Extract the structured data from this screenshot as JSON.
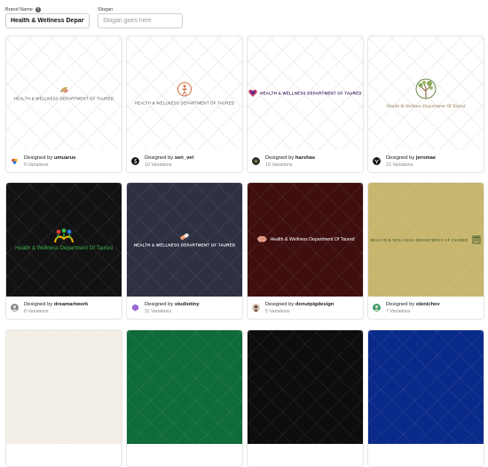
{
  "form": {
    "brand_label": "Brand Name",
    "brand_value": "Health & Wellness Departme",
    "slogan_label": "Slogan",
    "slogan_placeholder": "Slogan goes here"
  },
  "cards": [
    {
      "bg": "#ffffff",
      "logo_text": "HEALTH & WELLNESS DEPARTMENT OF TAURED",
      "text_color": "#444444",
      "designed_prefix": "Designed by",
      "designer": "umuarus",
      "variations": "9 Variations",
      "icon": "leaf-icon"
    },
    {
      "bg": "#ffffff",
      "logo_text": "HEALTH & WELLNESS DEPARTMENT OF TAURED",
      "text_color": "#444444",
      "designed_prefix": "Designed by",
      "designer": "sen_vel",
      "variations": "10 Variations",
      "icon": "circle-figure-icon"
    },
    {
      "bg": "#ffffff",
      "logo_text": "HEALTH & WELLNESS DEPARTMENT OF TAURED",
      "text_color": "#3a1a5c",
      "designed_prefix": "Designed by",
      "designer": "harshas",
      "variations": "15 Variations",
      "icon": "heart-icon"
    },
    {
      "bg": "#ffffff",
      "logo_text": "Health & Wellness Department Of Taured",
      "text_color": "#8a7a45",
      "designed_prefix": "Designed by",
      "designer": "jeromae",
      "variations": "22 Variations",
      "icon": "tree-icon"
    },
    {
      "bg": "#121212",
      "logo_text": "Health & Wellness Department Of Taured",
      "text_color": "#3bb34a",
      "designed_prefix": "Designed by",
      "designer": "dreamartwork",
      "variations": "8 Variations",
      "icon": "people-icon"
    },
    {
      "bg": "#2d3142",
      "logo_text": "HEALTH & WELLNESS DEPARTMENT OF TAURED",
      "text_color": "#ffffff",
      "designed_prefix": "Designed by",
      "designer": "studiotiny",
      "variations": "11 Variations",
      "icon": "pill-icon"
    },
    {
      "bg": "#3f0f0f",
      "logo_text": "Health & Wellness Department Of Taured",
      "text_color": "#ffffff",
      "designed_prefix": "Designed by",
      "designer": "donutpigdesign",
      "variations": "5 Variations",
      "icon": "brain-icon"
    },
    {
      "bg": "#c6b66e",
      "logo_text": "HEALTH & WELLNESS DEPARTMENT OF TAURED",
      "text_color": "#2f4a1f",
      "designed_prefix": "Designed by",
      "designer": "olenichev",
      "variations": "7 Variations",
      "icon": "building-icon"
    },
    {
      "bg": "#f3efe6"
    },
    {
      "bg": "#0f6b3a"
    },
    {
      "bg": "#0d0d0d"
    },
    {
      "bg": "#0a2a8a"
    }
  ]
}
